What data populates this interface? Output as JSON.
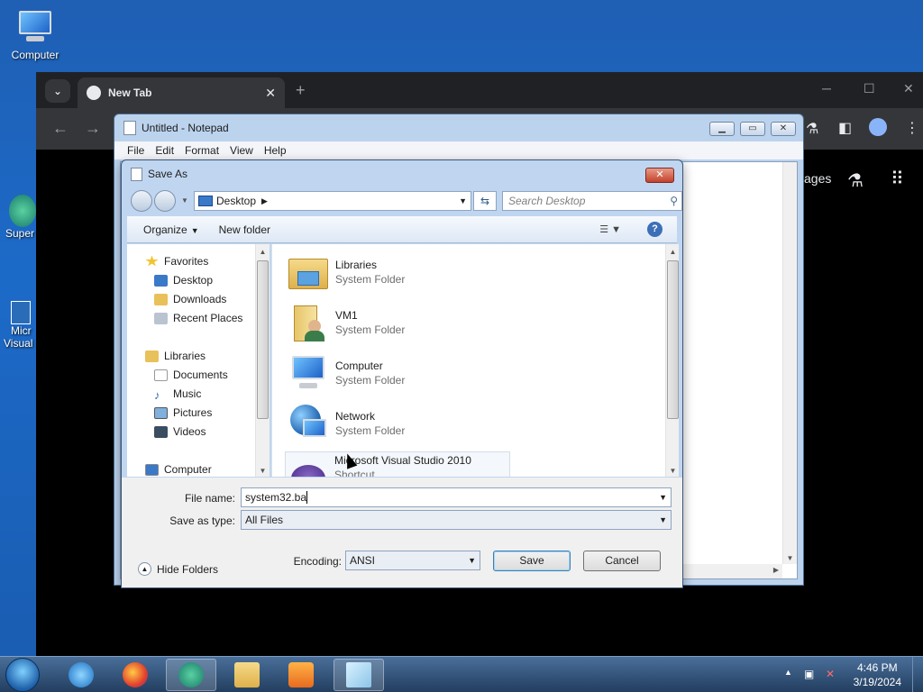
{
  "desktop": {
    "icons": [
      {
        "label": "Computer"
      }
    ],
    "partial_icons": [
      {
        "label": "Super"
      },
      {
        "label": "Micr"
      },
      {
        "label": "Visual"
      }
    ]
  },
  "chrome": {
    "tab_title": "New Tab",
    "tab_close": "✕",
    "new_tab": "+",
    "page_text": "ages"
  },
  "notepad": {
    "title": "Untitled - Notepad",
    "menu": [
      "File",
      "Edit",
      "Format",
      "View",
      "Help"
    ]
  },
  "dialog": {
    "title": "Save As",
    "address": "Desktop",
    "search_placeholder": "Search Desktop",
    "toolbar": {
      "organize": "Organize",
      "new_folder": "New folder"
    },
    "nav": {
      "favorites": "Favorites",
      "fav_items": [
        "Desktop",
        "Downloads",
        "Recent Places"
      ],
      "libraries": "Libraries",
      "lib_items": [
        "Documents",
        "Music",
        "Pictures",
        "Videos"
      ],
      "computer": "Computer"
    },
    "files": [
      {
        "name": "Libraries",
        "type": "System Folder"
      },
      {
        "name": "VM1",
        "type": "System Folder"
      },
      {
        "name": "Computer",
        "type": "System Folder"
      },
      {
        "name": "Network",
        "type": "System Folder"
      },
      {
        "name": "Microsoft Visual Studio 2010",
        "type": "Shortcut"
      }
    ],
    "file_name_label": "File name:",
    "file_name_value": "system32.ba",
    "save_type_label": "Save as type:",
    "save_type_value": "All Files",
    "encoding_label": "Encoding:",
    "encoding_value": "ANSI",
    "save": "Save",
    "cancel": "Cancel",
    "hide_folders": "Hide Folders"
  },
  "taskbar": {
    "time": "4:46 PM",
    "date": "3/19/2024"
  },
  "colors": {
    "accent": "#1c6ac8",
    "taskbar": "#233e5f"
  }
}
